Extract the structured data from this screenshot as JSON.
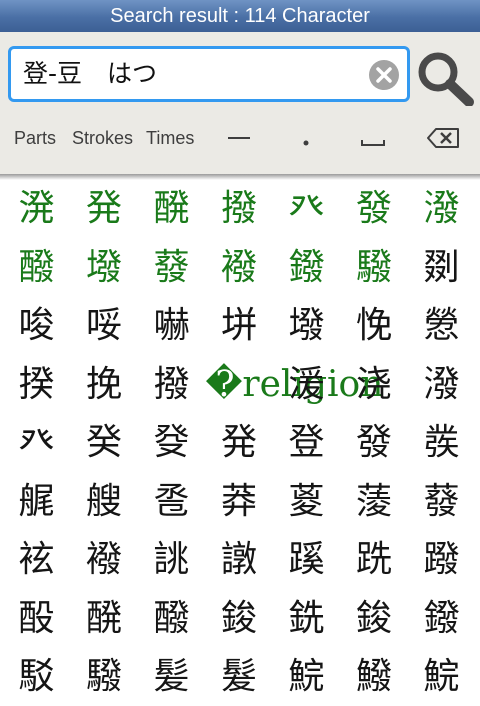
{
  "title": "Search result : 114 Character",
  "search": {
    "value": "登-豆　はつ"
  },
  "toolbar": {
    "parts": "Parts",
    "strokes": "Strokes",
    "times": "Times"
  },
  "results": [
    {
      "ch": "溌",
      "hl": true
    },
    {
      "ch": "発",
      "hl": true
    },
    {
      "ch": "醗",
      "hl": true
    },
    {
      "ch": "撥",
      "hl": true
    },
    {
      "ch": "癶",
      "hl": true
    },
    {
      "ch": "發",
      "hl": true
    },
    {
      "ch": "潑",
      "hl": true
    },
    {
      "ch": "醱",
      "hl": true
    },
    {
      "ch": "墢",
      "hl": true
    },
    {
      "ch": "蕟",
      "hl": true
    },
    {
      "ch": "襏",
      "hl": true
    },
    {
      "ch": "鏺",
      "hl": true
    },
    {
      "ch": "驋",
      "hl": true
    },
    {
      "ch": "剟",
      "hl": false
    },
    {
      "ch": "唆",
      "hl": false
    },
    {
      "ch": "哸",
      "hl": false
    },
    {
      "ch": "嚇",
      "hl": false
    },
    {
      "ch": "垪",
      "hl": false
    },
    {
      "ch": "墢",
      "hl": false
    },
    {
      "ch": "悗",
      "hl": false
    },
    {
      "ch": "憥",
      "hl": false
    },
    {
      "ch": "揆",
      "hl": false
    },
    {
      "ch": "挽",
      "hl": false
    },
    {
      "ch": "撥",
      "hl": false
    },
    {
      "ch": "�religion",
      "hl": true
    },
    {
      "ch": "湲",
      "hl": false
    },
    {
      "ch": "浇",
      "hl": false
    },
    {
      "ch": "潑",
      "hl": false
    },
    {
      "ch": "癶",
      "hl": false
    },
    {
      "ch": "癸",
      "hl": false
    },
    {
      "ch": "癹",
      "hl": false
    },
    {
      "ch": "発",
      "hl": false
    },
    {
      "ch": "登",
      "hl": false
    },
    {
      "ch": "發",
      "hl": false
    },
    {
      "ch": "彂",
      "hl": false
    },
    {
      "ch": "艉",
      "hl": false
    },
    {
      "ch": "艘",
      "hl": false
    },
    {
      "ch": "卺",
      "hl": false
    },
    {
      "ch": "莽",
      "hl": false
    },
    {
      "ch": "葼",
      "hl": false
    },
    {
      "ch": "蔆",
      "hl": false
    },
    {
      "ch": "蕟",
      "hl": false
    },
    {
      "ch": "袨",
      "hl": false
    },
    {
      "ch": "襏",
      "hl": false
    },
    {
      "ch": "誂",
      "hl": false
    },
    {
      "ch": "譈",
      "hl": false
    },
    {
      "ch": "蹊",
      "hl": false
    },
    {
      "ch": "跣",
      "hl": false
    },
    {
      "ch": "蹳",
      "hl": false
    },
    {
      "ch": "酘",
      "hl": false
    },
    {
      "ch": "醗",
      "hl": false
    },
    {
      "ch": "醱",
      "hl": false
    },
    {
      "ch": "鋑",
      "hl": false
    },
    {
      "ch": "銑",
      "hl": false
    },
    {
      "ch": "鋑",
      "hl": false
    },
    {
      "ch": "鏺",
      "hl": false
    },
    {
      "ch": "駁",
      "hl": false
    },
    {
      "ch": "驋",
      "hl": false
    },
    {
      "ch": "髪",
      "hl": false
    },
    {
      "ch": "髮",
      "hl": false
    },
    {
      "ch": "鯇",
      "hl": false
    },
    {
      "ch": "鱍",
      "hl": false
    },
    {
      "ch": "鯇",
      "hl": false
    }
  ]
}
